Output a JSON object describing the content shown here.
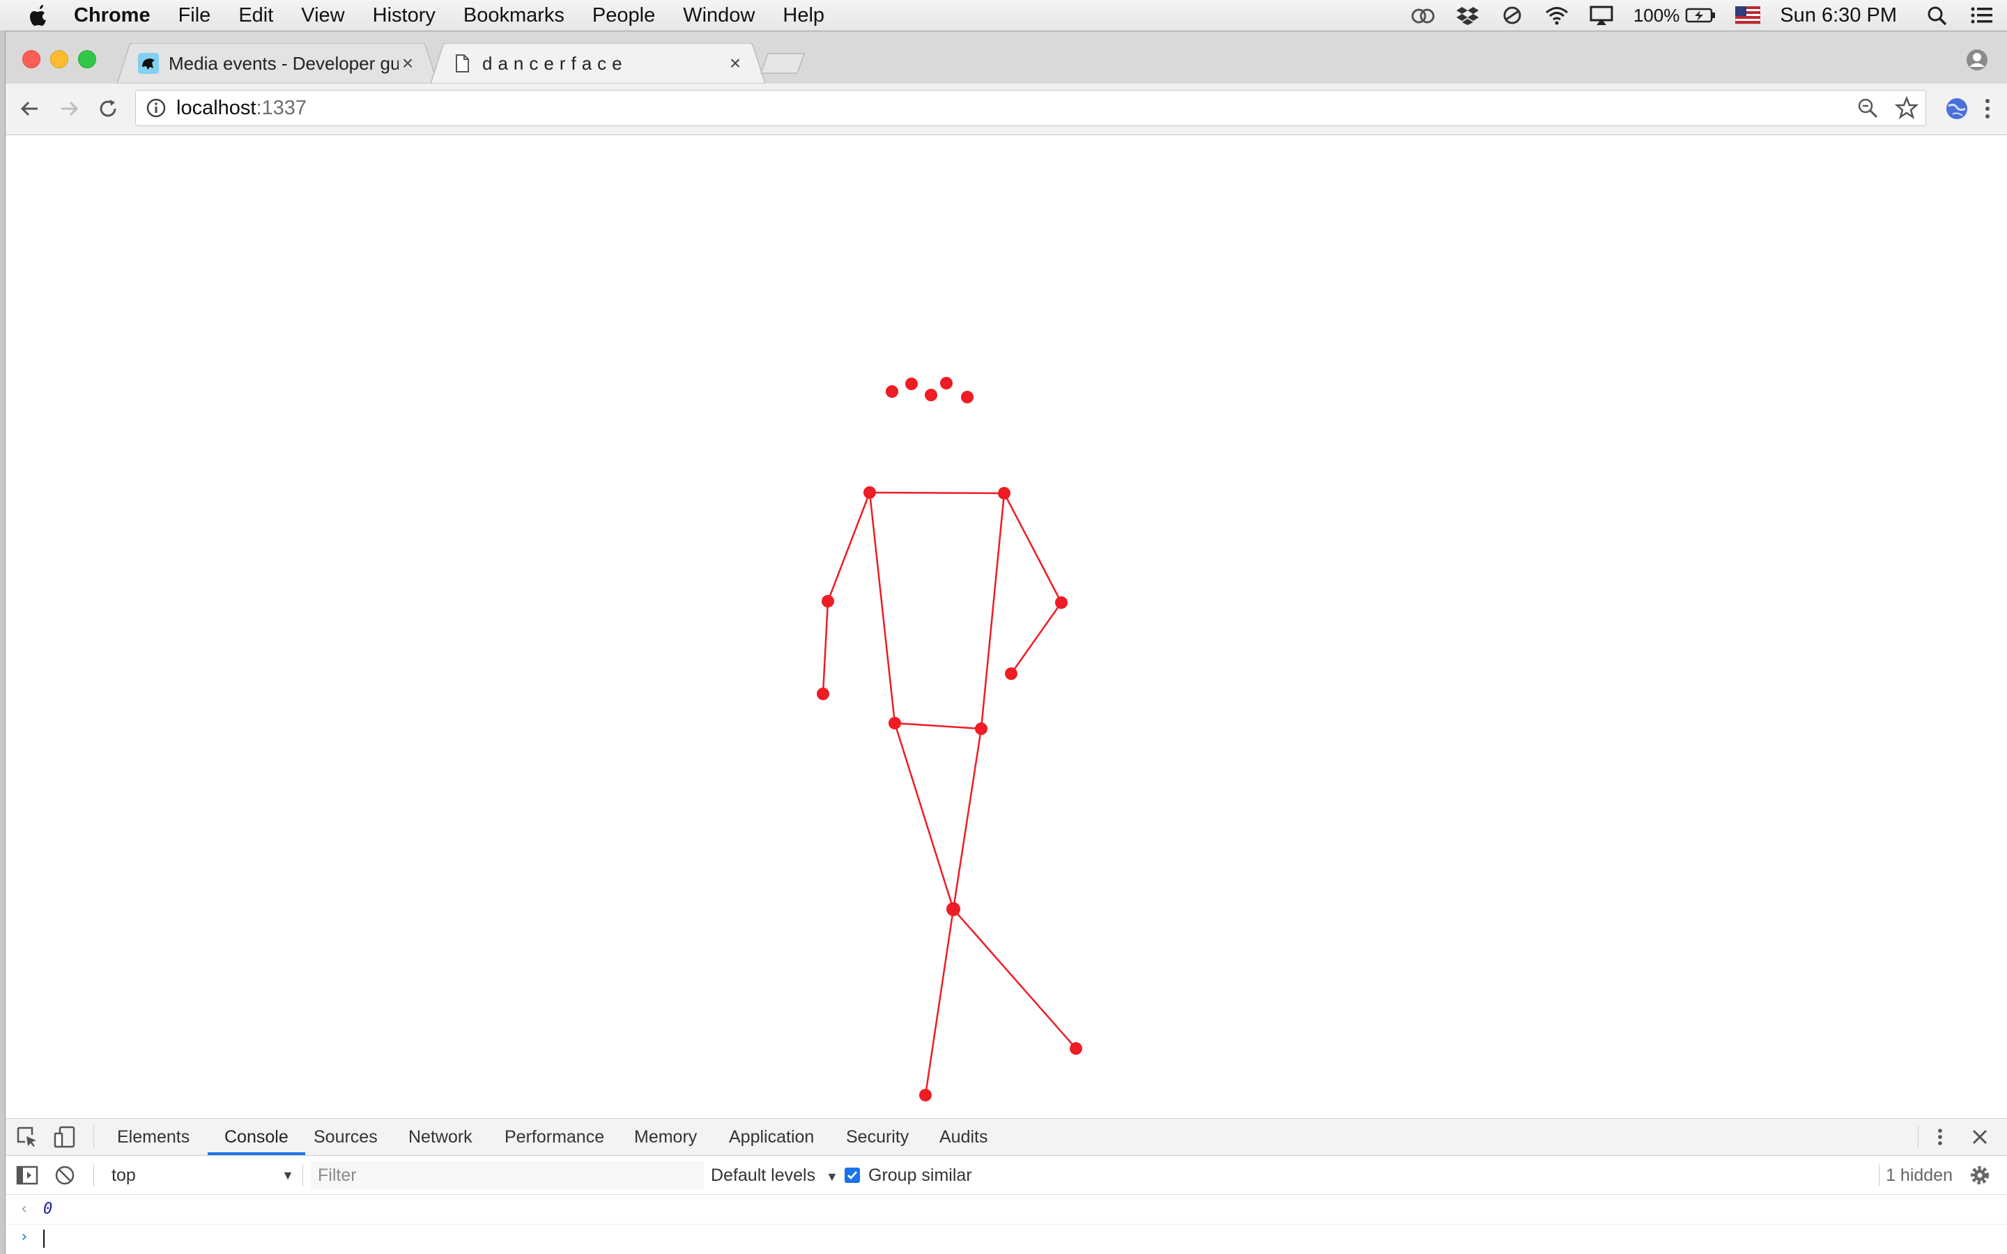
{
  "menubar": {
    "app_name": "Chrome",
    "items": [
      "File",
      "Edit",
      "View",
      "History",
      "Bookmarks",
      "People",
      "Window",
      "Help"
    ],
    "battery": "100%",
    "clock": "Sun 6:30 PM"
  },
  "tabs": [
    {
      "title": "Media events - Developer guid",
      "favicon": "mdn-dinosaur-icon"
    },
    {
      "title": "dancerface",
      "favicon": "page-icon"
    }
  ],
  "address": {
    "host": "localhost",
    "port": ":1337"
  },
  "devtools": {
    "tabs": [
      "Elements",
      "Console",
      "Sources",
      "Network",
      "Performance",
      "Memory",
      "Application",
      "Security",
      "Audits"
    ],
    "active_tab": "Console",
    "context": "top",
    "filter_placeholder": "Filter",
    "levels": "Default levels",
    "group_similar": "Group similar",
    "hidden": "1 hidden",
    "console_result": "0"
  },
  "colors": {
    "skeleton": "#ee1c24",
    "accent": "#1a73e8"
  }
}
